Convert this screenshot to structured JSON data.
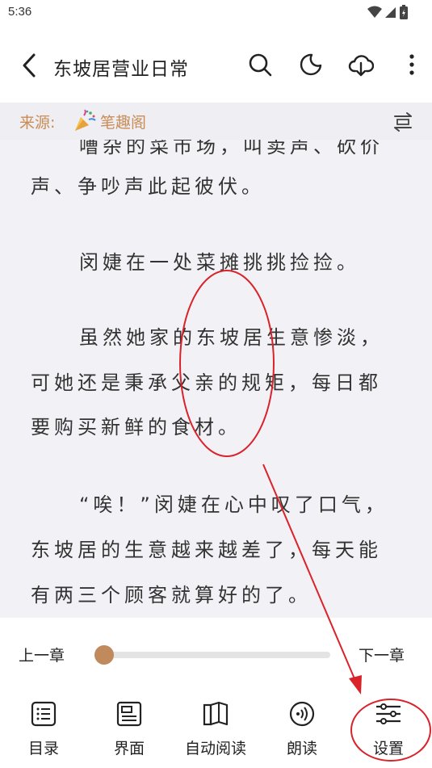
{
  "status_bar": {
    "time": "5:36"
  },
  "header": {
    "title": "东坡居营业日常"
  },
  "source": {
    "label": "来源:",
    "name": "笔趣阁"
  },
  "reader": {
    "lines": [
      "嘈杂的菜市场，叫卖声、砍价",
      "声、争吵声此起彼伏。",
      "闵婕在一处菜摊挑挑捡捡。",
      "虽然她家的东坡居生意惨淡，",
      "可她还是秉承父亲的规矩，每日都",
      "要购买新鲜的食材。",
      "“唉！”闵婕在心中叹了口气，",
      "东坡居的生意越来越差了，每天能",
      "有两三个顾客就算好的了。"
    ]
  },
  "progress": {
    "prev_label": "上一章",
    "next_label": "下一章",
    "value": 0.0
  },
  "bottom_nav": {
    "items": [
      {
        "label": "目录",
        "icon": "toc-list-icon"
      },
      {
        "label": "界面",
        "icon": "layout-icon"
      },
      {
        "label": "自动阅读",
        "icon": "book-icon"
      },
      {
        "label": "朗读",
        "icon": "read-aloud-icon"
      },
      {
        "label": "设置",
        "icon": "sliders-icon"
      }
    ]
  },
  "colors": {
    "accent": "#c08a5d",
    "source_text": "#c98c55",
    "annotation": "#d9222a",
    "reader_bg": "#f2f1f5"
  }
}
